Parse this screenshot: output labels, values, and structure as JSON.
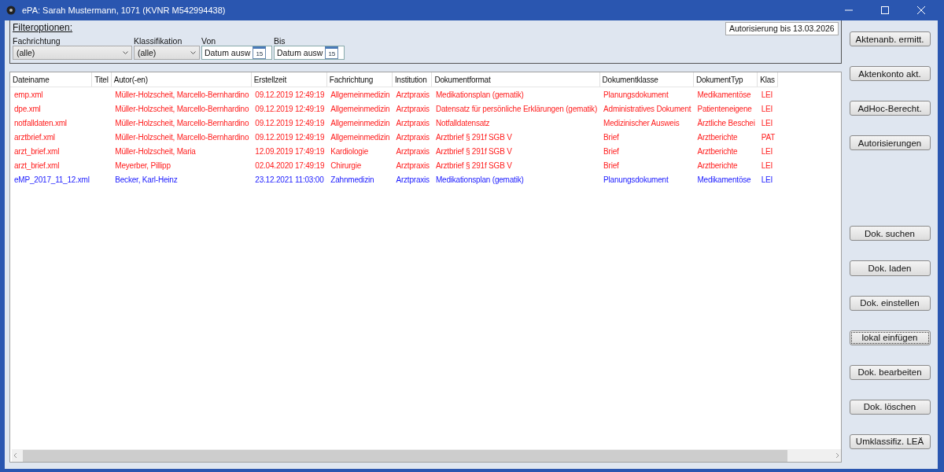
{
  "window": {
    "title": "ePA: Sarah Mustermann, 1071 (KVNR M542994438)"
  },
  "filter": {
    "title": "Filteroptionen:",
    "authorization": "Autorisierung bis 13.03.2026",
    "fields": [
      {
        "kind": "combo",
        "label": "Fachrichtung",
        "value": "(alle)"
      },
      {
        "kind": "combo",
        "label": "Klassifikation",
        "value": "(alle)"
      },
      {
        "kind": "date",
        "label": "Von",
        "value": "Datum ausw",
        "calendar_day": "15"
      },
      {
        "kind": "date",
        "label": "Bis",
        "value": "Datum ausw",
        "calendar_day": "15"
      }
    ]
  },
  "table": {
    "columns": [
      "Dateiname",
      "Titel",
      "Autor(-en)",
      "Erstellzeit",
      "Fachrichtung",
      "Institution",
      "Dokumentformat",
      "Dokumentklasse",
      "DokumentTyp",
      "Klas"
    ],
    "rows": [
      {
        "color": "#ff2020",
        "cells": [
          "emp.xml",
          "",
          "Müller-Holzscheit, Marcello-Bernhardino",
          "09.12.2019 12:49:19",
          "Allgemeinmedizin",
          "Arztpraxis",
          "Medikationsplan (gematik)",
          "Planungsdokument",
          "Medikamentöse",
          "LEI"
        ]
      },
      {
        "color": "#ff2020",
        "cells": [
          "dpe.xml",
          "",
          "Müller-Holzscheit, Marcello-Bernhardino",
          "09.12.2019 12:49:19",
          "Allgemeinmedizin",
          "Arztpraxis",
          "Datensatz für persönliche Erklärungen (gematik)",
          "Administratives Dokument",
          "Patienteneigene",
          "LEI"
        ]
      },
      {
        "color": "#ff2020",
        "cells": [
          "notfalldaten.xml",
          "",
          "Müller-Holzscheit, Marcello-Bernhardino",
          "09.12.2019 12:49:19",
          "Allgemeinmedizin",
          "Arztpraxis",
          "Notfalldatensatz",
          "Medizinischer Ausweis",
          "Ärztliche Beschei",
          "LEI"
        ]
      },
      {
        "color": "#ff2020",
        "cells": [
          "arztbrief.xml",
          "",
          "Müller-Holzscheit, Marcello-Bernhardino",
          "09.12.2019 12:49:19",
          "Allgemeinmedizin",
          "Arztpraxis",
          "Arztbrief § 291f SGB V",
          "Brief",
          "Arztberichte",
          "PAT"
        ]
      },
      {
        "color": "#ff2020",
        "cells": [
          "arzt_brief.xml",
          "",
          "Müller-Holzscheit, Maria",
          "12.09.2019 17:49:19",
          "Kardiologie",
          "Arztpraxis",
          "Arztbrief § 291f SGB V",
          "Brief",
          "Arztberichte",
          "LEI"
        ]
      },
      {
        "color": "#ff2020",
        "cells": [
          "arzt_brief.xml",
          "",
          "Meyerber, Pillipp",
          "02.04.2020 17:49:19",
          "Chirurgie",
          "Arztpraxis",
          "Arztbrief § 291f SGB V",
          "Brief",
          "Arztberichte",
          "LEI"
        ]
      },
      {
        "color": "#1a1aff",
        "cells": [
          "eMP_2017_11_12.xml",
          "",
          "Becker, Karl-Heinz",
          "23.12.2021 11:03:00",
          "Zahnmedizin",
          "Arztpraxis",
          "Medikationsplan (gematik)",
          "Planungsdokument",
          "Medikamentöse",
          "LEI"
        ]
      }
    ]
  },
  "buttons_top": [
    {
      "label": "Aktenanb. ermitt.",
      "focused": false
    },
    {
      "label": "Aktenkonto akt.",
      "focused": false
    },
    {
      "label": "AdHoc-Berecht.",
      "focused": false
    },
    {
      "label": "Autorisierungen",
      "focused": false
    }
  ],
  "buttons_bottom": [
    {
      "label": "Dok. suchen",
      "focused": false
    },
    {
      "label": "Dok. laden",
      "focused": false
    },
    {
      "label": "Dok. einstellen",
      "focused": false
    },
    {
      "label": "lokal einfügen",
      "focused": true
    },
    {
      "label": "Dok. bearbeiten",
      "focused": false
    },
    {
      "label": "Dok. löschen",
      "focused": false
    },
    {
      "label": "Umklassifiz. LEÄ",
      "focused": false
    }
  ]
}
